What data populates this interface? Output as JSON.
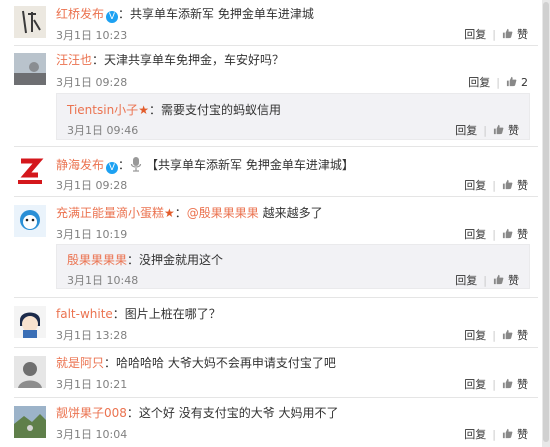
{
  "comments": [
    {
      "username": "红桥发布",
      "content": "：共享单车添新军 免押金单车进津城",
      "time": "3月1日 10:23",
      "reply_label": "回复",
      "like_label": "赞"
    },
    {
      "username": "汪汪也",
      "content": "：天津共享单车免押金，车安好吗？",
      "time": "3月1日 09:28",
      "reply_label": "回复",
      "like_count": "2"
    },
    {
      "username": "Tientsin小子",
      "content": "：需要支付宝的蚂蚁信用",
      "time": "3月1日 09:46",
      "reply_label": "回复",
      "like_label": "赞"
    },
    {
      "username": "静海发布",
      "content": "【共享单车添新军 免押金单车进津城】",
      "time": "3月1日 09:28",
      "reply_label": "回复",
      "like_label": "赞"
    },
    {
      "username": "充满正能量滴小蛋糕",
      "content_prefix": "：",
      "mention": "@殷果果果果",
      "content": " 越来越多了",
      "time": "3月1日 10:19",
      "reply_label": "回复",
      "like_label": "赞"
    },
    {
      "username": "殷果果果果",
      "content": "：没押金就用这个",
      "time": "3月1日 10:48",
      "reply_label": "回复",
      "like_label": "赞"
    },
    {
      "username": "falt-white",
      "content": "：图片上桩在哪了？",
      "time": "3月1日 13:28",
      "reply_label": "回复",
      "like_label": "赞"
    },
    {
      "username": "就是阿只",
      "content": "：哈哈哈哈 大爷大妈不会再申请支付宝了吧",
      "time": "3月1日 10:21",
      "reply_label": "回复",
      "like_label": "赞"
    },
    {
      "username": "靓饼果子008",
      "content": "：这个好 没有支付宝的大爷 大妈用不了",
      "time": "3月1日 10:04",
      "reply_label": "回复",
      "like_label": "赞"
    }
  ],
  "colors": {
    "username": "#eb7350",
    "text": "#333333",
    "meta": "#808080",
    "reply_bg": "#f2f2f5"
  }
}
